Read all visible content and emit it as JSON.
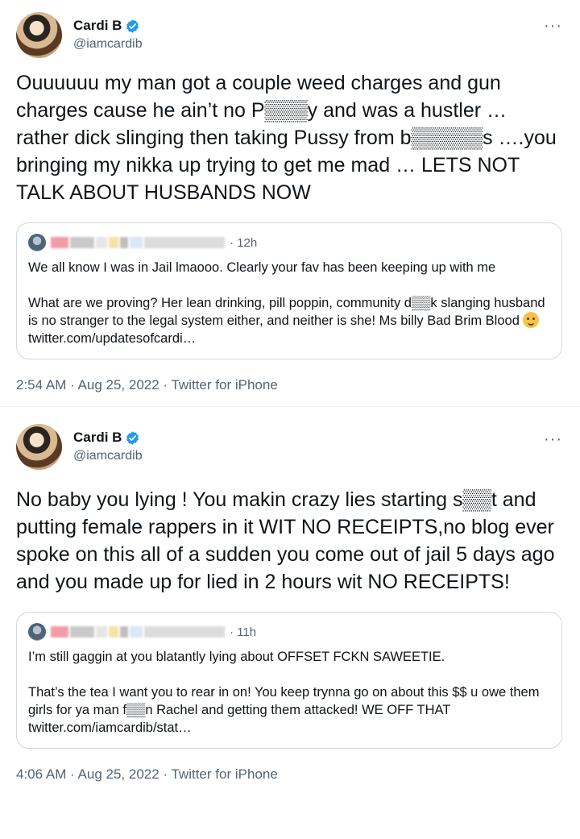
{
  "tweets": [
    {
      "display_name": "Cardi B",
      "handle": "@iamcardib",
      "more_icon": "more-horizontal-icon",
      "text": "Ouuuuuu my man got a couple weed charges and gun charges cause he ain’t no P▒▒▒y and was a hustler  … rather dick slinging then taking  Pussy from b▒▒▒▒▒s ….you bringing my nikka up trying to get me mad … LETS NOT TALK ABOUT HUSBANDS NOW",
      "quote": {
        "time": "12h",
        "text_line1": "We all know I was in Jail lmaooo. Clearly your fav has been keeping up with me",
        "text_para2": "What are we proving? Her lean drinking, pill poppin, community d▒▒k  slanging husband is no stranger to the legal system either, and neither is she! Ms billy Bad Brim Blood",
        "text_after_emoji": " twitter.com/updatesofcardi…"
      },
      "meta": "2:54 AM · Aug 25, 2022 · Twitter for iPhone"
    },
    {
      "display_name": "Cardi B",
      "handle": "@iamcardib",
      "more_icon": "more-horizontal-icon",
      "text": "No baby you lying ! You makin crazy lies starting s▒▒t and putting female rappers in it WIT NO RECEIPTS,no blog ever spoke on this all of a sudden you come out of jail 5 days ago and you made up for lied in 2 hours wit NO RECEIPTS!",
      "quote": {
        "time": "11h",
        "text_line1": "I’m still gaggin at you blatantly lying about OFFSET FCKN SAWEETIE.",
        "text_para2": "That’s the tea I want you to rear in on! You keep trynna go on about this $$ u owe them girls for ya man f▒▒n Rachel and getting them attacked! WE OFF THAT twitter.com/iamcardib/stat…"
      },
      "meta": "4:06 AM · Aug 25, 2022 · Twitter for iPhone"
    }
  ],
  "colors": {
    "text": "#0f1419",
    "secondary": "#536471",
    "verified": "#1d9bf0",
    "border": "#cfd9de"
  }
}
